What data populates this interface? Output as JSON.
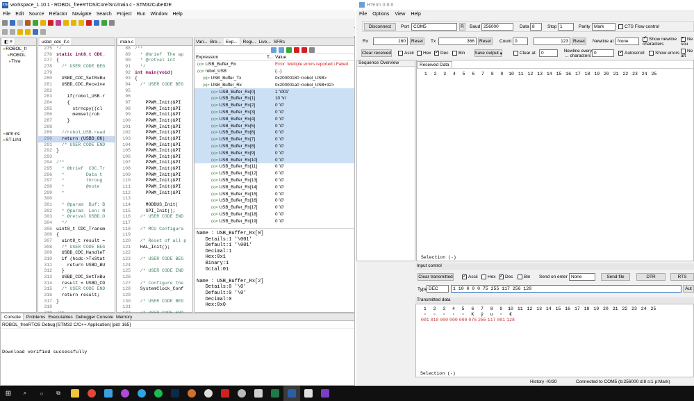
{
  "ide": {
    "title": "workspace_1.10.1 - ROBOL_freeRTOS/Core/Src/main.c - STM32CubeIDE",
    "menu": [
      "File",
      "Edit",
      "Source",
      "Refactor",
      "Navigate",
      "Search",
      "Project",
      "Run",
      "Window",
      "Help"
    ],
    "project_tree": [
      "ROBOL_fr",
      "ROBOL",
      "Thre",
      "arm-nc",
      "ST-LINI"
    ],
    "editor1": {
      "tab": "usbd_cdc_if.c",
      "lines": [
        {
          "n": "275",
          "t": "*/",
          "c": "cm"
        },
        {
          "n": "276",
          "t": "static int8_t CDC_",
          "c": "kw"
        },
        {
          "n": "277",
          "t": "{",
          "c": ""
        },
        {
          "n": "278",
          "t": "  /* USER CODE BEG",
          "c": "cm"
        },
        {
          "n": "279",
          "t": "",
          "c": ""
        },
        {
          "n": "280",
          "t": "  USBD_CDC_SetRxBu",
          "c": ""
        },
        {
          "n": "281",
          "t": "  USBD_CDC_Receive",
          "c": ""
        },
        {
          "n": "282",
          "t": "",
          "c": ""
        },
        {
          "n": "283",
          "t": "    if(robol_USB.r",
          "c": ""
        },
        {
          "n": "284",
          "t": "    {",
          "c": ""
        },
        {
          "n": "285",
          "t": "      strncpy((cl",
          "c": ""
        },
        {
          "n": "286",
          "t": "      memset(rob",
          "c": ""
        },
        {
          "n": "287",
          "t": "    }",
          "c": ""
        },
        {
          "n": "288",
          "t": "",
          "c": ""
        },
        {
          "n": "289",
          "t": "  //robol_USB.read",
          "c": "cm"
        },
        {
          "n": "290",
          "t": "  return (USBD_OK)",
          "c": "hl"
        },
        {
          "n": "291",
          "t": "  /* USER CODE END",
          "c": "cm"
        },
        {
          "n": "292",
          "t": "}",
          "c": ""
        },
        {
          "n": "293",
          "t": "",
          "c": ""
        },
        {
          "n": "294",
          "t": "/**",
          "c": "cm"
        },
        {
          "n": "295",
          "t": "  * @brief  CDC_Tr",
          "c": "cm"
        },
        {
          "n": "296",
          "t": "  *        Data t",
          "c": "cm"
        },
        {
          "n": "297",
          "t": "  *        throug",
          "c": "cm"
        },
        {
          "n": "298",
          "t": "  *        @note",
          "c": "cm"
        },
        {
          "n": "299",
          "t": "  *",
          "c": "cm"
        },
        {
          "n": "300",
          "t": "",
          "c": ""
        },
        {
          "n": "301",
          "t": "  * @param  Buf: B",
          "c": "cm"
        },
        {
          "n": "302",
          "t": "  * @param  Len: N",
          "c": "cm"
        },
        {
          "n": "303",
          "t": "  * @retval USBD_O",
          "c": "cm"
        },
        {
          "n": "304",
          "t": "  */",
          "c": "cm"
        },
        {
          "n": "305",
          "t": "uint8_t CDC_Transm",
          "c": ""
        },
        {
          "n": "306",
          "t": "{",
          "c": ""
        },
        {
          "n": "307",
          "t": "  uint8_t result =",
          "c": ""
        },
        {
          "n": "308",
          "t": "  /* USER CODE BEG",
          "c": "cm"
        },
        {
          "n": "309",
          "t": "  USBD_CDC_HandleT",
          "c": ""
        },
        {
          "n": "310",
          "t": "  if (hcdc->TxStat",
          "c": ""
        },
        {
          "n": "311",
          "t": "    return USBD_BU",
          "c": ""
        },
        {
          "n": "312",
          "t": "  }",
          "c": ""
        },
        {
          "n": "313",
          "t": "  USBD_CDC_SetTxBu",
          "c": ""
        },
        {
          "n": "314",
          "t": "  result = USBD_CD",
          "c": ""
        },
        {
          "n": "315",
          "t": "  /* USER CODE END",
          "c": "cm"
        },
        {
          "n": "316",
          "t": "  return result;",
          "c": ""
        },
        {
          "n": "317",
          "t": "}",
          "c": ""
        },
        {
          "n": "318",
          "t": "",
          "c": ""
        },
        {
          "n": "319",
          "t": "/**",
          "c": "cm"
        }
      ]
    },
    "editor2": {
      "tab": "main.c",
      "lines": [
        {
          "n": "88",
          "t": "/**",
          "c": "cm"
        },
        {
          "n": "89",
          "t": "  * @brief  The ap",
          "c": "cm"
        },
        {
          "n": "90",
          "t": "  * @retval int",
          "c": "cm"
        },
        {
          "n": "91",
          "t": "  */",
          "c": "cm"
        },
        {
          "n": "92",
          "t": "int main(void)",
          "c": "kw"
        },
        {
          "n": "93",
          "t": "{",
          "c": ""
        },
        {
          "n": "94",
          "t": "  /* USER CODE BEG",
          "c": "cm"
        },
        {
          "n": "95",
          "t": "",
          "c": ""
        },
        {
          "n": "96",
          "t": "",
          "c": ""
        },
        {
          "n": "97",
          "t": "    PPWM_Init(&PI",
          "c": ""
        },
        {
          "n": "98",
          "t": "    PPWM_Init(&PI",
          "c": ""
        },
        {
          "n": "99",
          "t": "    PPWM_Init(&PI",
          "c": ""
        },
        {
          "n": "100",
          "t": "    PPWM_Init(&PI",
          "c": ""
        },
        {
          "n": "101",
          "t": "    PPWM_Init(&PI",
          "c": ""
        },
        {
          "n": "102",
          "t": "    PPWM_Init(&PI",
          "c": ""
        },
        {
          "n": "103",
          "t": "    PPWM_Init(&PI",
          "c": ""
        },
        {
          "n": "104",
          "t": "    PPWM_Init(&PI",
          "c": ""
        },
        {
          "n": "105",
          "t": "    PPWM_Init(&PI",
          "c": ""
        },
        {
          "n": "106",
          "t": "    PPWM_Init(&PI",
          "c": ""
        },
        {
          "n": "107",
          "t": "    PPWM_Init(&PI",
          "c": ""
        },
        {
          "n": "108",
          "t": "    PPWM_Init(&PI",
          "c": ""
        },
        {
          "n": "109",
          "t": "    PPWM_Init(&PI",
          "c": ""
        },
        {
          "n": "110",
          "t": "    PPWM_Init(&PI",
          "c": ""
        },
        {
          "n": "111",
          "t": "    PPWM_Init(&PI",
          "c": ""
        },
        {
          "n": "112",
          "t": "    PPWM_Init(&PI",
          "c": ""
        },
        {
          "n": "113",
          "t": "",
          "c": ""
        },
        {
          "n": "114",
          "t": "    MODBUS_Init(",
          "c": ""
        },
        {
          "n": "115",
          "t": "    SPI_Init();",
          "c": ""
        },
        {
          "n": "116",
          "t": "  /* USER CODE END",
          "c": "cm"
        },
        {
          "n": "117",
          "t": "",
          "c": ""
        },
        {
          "n": "118",
          "t": "  /* MCU Configura",
          "c": "cm"
        },
        {
          "n": "119",
          "t": "",
          "c": ""
        },
        {
          "n": "120",
          "t": "  /* Reset of all p",
          "c": "cm"
        },
        {
          "n": "121",
          "t": "  HAL_Init();",
          "c": ""
        },
        {
          "n": "122",
          "t": "",
          "c": ""
        },
        {
          "n": "123",
          "t": "  /* USER CODE BEG",
          "c": "cm"
        },
        {
          "n": "124",
          "t": "",
          "c": ""
        },
        {
          "n": "125",
          "t": "  /* USER CODE END",
          "c": "cm"
        },
        {
          "n": "126",
          "t": "",
          "c": ""
        },
        {
          "n": "127",
          "t": "  /* Configure the",
          "c": "cm"
        },
        {
          "n": "128",
          "t": "  SystemClock_Conf",
          "c": ""
        },
        {
          "n": "129",
          "t": "",
          "c": ""
        },
        {
          "n": "130",
          "t": "  /* USER CODE BEG",
          "c": "cm"
        },
        {
          "n": "131",
          "t": "",
          "c": ""
        },
        {
          "n": "132",
          "t": "  /* USER CODE END",
          "c": "cm"
        }
      ]
    },
    "expressions": {
      "tabs": [
        "Vari...",
        "Bre...",
        "Exp...",
        "Regi...",
        "Live...",
        "SFRs"
      ],
      "col_expression": "Expression",
      "col_type": "T...",
      "col_value": "Value",
      "rows": [
        {
          "e": "USB_Buffer_Rx",
          "t": "",
          "v": "Error: Multiple errors reported.\\ Failed",
          "err": true,
          "sel": false,
          "ind": 4
        },
        {
          "e": "robol_USB",
          "t": "",
          "v": "{...}",
          "err": false,
          "sel": false,
          "ind": 4
        },
        {
          "e": "USB_Buffer_Tx",
          "t": "",
          "v": "0x20000180 <robol_USB>",
          "err": false,
          "sel": false,
          "ind": 12
        },
        {
          "e": "USB_Buffer_Rx",
          "t": "",
          "v": "0x200001a0 <robol_USB+32>",
          "err": false,
          "sel": false,
          "ind": 12
        },
        {
          "e": "USB_Buffer_Rx[0]",
          "t": "",
          "v": "1 '\\001'",
          "err": false,
          "sel": true,
          "ind": 24
        },
        {
          "e": "USB_Buffer_Rx[1]",
          "t": "",
          "v": "10 '\\n'",
          "err": false,
          "sel": true,
          "ind": 24
        },
        {
          "e": "USB_Buffer_Rx[2]",
          "t": "",
          "v": "0 '\\0'",
          "err": false,
          "sel": true,
          "ind": 24
        },
        {
          "e": "USB_Buffer_Rx[3]",
          "t": "",
          "v": "0 '\\0'",
          "err": false,
          "sel": true,
          "ind": 24
        },
        {
          "e": "USB_Buffer_Rx[4]",
          "t": "",
          "v": "0 '\\0'",
          "err": false,
          "sel": true,
          "ind": 24
        },
        {
          "e": "USB_Buffer_Rx[5]",
          "t": "",
          "v": "0 '\\0'",
          "err": false,
          "sel": true,
          "ind": 24
        },
        {
          "e": "USB_Buffer_Rx[6]",
          "t": "",
          "v": "0 '\\0'",
          "err": false,
          "sel": true,
          "ind": 24
        },
        {
          "e": "USB_Buffer_Rx[7]",
          "t": "",
          "v": "0 '\\0'",
          "err": false,
          "sel": true,
          "ind": 24
        },
        {
          "e": "USB_Buffer_Rx[8]",
          "t": "",
          "v": "0 '\\0'",
          "err": false,
          "sel": true,
          "ind": 24
        },
        {
          "e": "USB_Buffer_Rx[9]",
          "t": "",
          "v": "0 '\\0'",
          "err": false,
          "sel": true,
          "ind": 24
        },
        {
          "e": "USB_Buffer_Rx[10]",
          "t": "",
          "v": "0 '\\0'",
          "err": false,
          "sel": true,
          "ind": 24
        },
        {
          "e": "USB_Buffer_Rx[11]",
          "t": "",
          "v": "0 '\\0'",
          "err": false,
          "sel": false,
          "ind": 24
        },
        {
          "e": "USB_Buffer_Rx[12]",
          "t": "",
          "v": "0 '\\0'",
          "err": false,
          "sel": false,
          "ind": 24
        },
        {
          "e": "USB_Buffer_Rx[13]",
          "t": "",
          "v": "0 '\\0'",
          "err": false,
          "sel": false,
          "ind": 24
        },
        {
          "e": "USB_Buffer_Rx[14]",
          "t": "",
          "v": "0 '\\0'",
          "err": false,
          "sel": false,
          "ind": 24
        },
        {
          "e": "USB_Buffer_Rx[15]",
          "t": "",
          "v": "0 '\\0'",
          "err": false,
          "sel": false,
          "ind": 24
        },
        {
          "e": "USB_Buffer_Rx[16]",
          "t": "",
          "v": "0 '\\0'",
          "err": false,
          "sel": false,
          "ind": 24
        },
        {
          "e": "USB_Buffer_Rx[17]",
          "t": "",
          "v": "0 '\\0'",
          "err": false,
          "sel": false,
          "ind": 24
        },
        {
          "e": "USB_Buffer_Rx[18]",
          "t": "",
          "v": "0 '\\0'",
          "err": false,
          "sel": false,
          "ind": 24
        },
        {
          "e": "USB_Buffer_Rx[19]",
          "t": "",
          "v": "0 '\\0'",
          "err": false,
          "sel": false,
          "ind": 24
        }
      ],
      "details": [
        "Name : USB_Buffer_Rx[0]",
        "   Details:1 '\\001'",
        "   Default:1 '\\001'",
        "   Decimal:1",
        "   Hex:0x1",
        "   Binary:1",
        "   Octal:01",
        "",
        "Name : USB_Buffer_Rx[2]",
        "   Details:0 '\\0'",
        "   Default:0 '\\0'",
        "   Decimal:0",
        "   Hex:0x0"
      ]
    },
    "console": {
      "tabs": [
        "Console",
        "Problems",
        "Executables",
        "Debugger Console",
        "Memory"
      ],
      "session": "ROBOL_freeRTOS Debug [STM32 C/C++ Application] [pid: 165]",
      "message": "Download verified successfully"
    }
  },
  "hterm": {
    "title": "HTerm 0.8.8",
    "menu": [
      "File",
      "Options",
      "View",
      "Help"
    ],
    "disconnect": "Disconnect",
    "port_label": "Port",
    "port_value": "COM5",
    "r_button": "R",
    "baud_label": "Baud",
    "baud_value": "256000",
    "data_label": "Data",
    "data_value": "8",
    "stop_label": "Stop",
    "stop_value": "1",
    "parity_label": "Parity",
    "parity_value": "Mark",
    "cts_label": "CTS Flow control",
    "rx_label": "Rx",
    "rx_value": "160",
    "reset": "Reset",
    "tx_label": "Tx",
    "tx_value": "366",
    "count_label": "Count",
    "count_value": "0",
    "count_value2": "123",
    "newline_at_label": "Newline at",
    "newline_at_value": "None",
    "show_newline": "Show newline characters",
    "ne_cut": "Ne sou",
    "clear_received": "Clear received",
    "ascii": "Ascii",
    "hex": "Hex",
    "dec": "Dec",
    "bin": "Bin",
    "save_output": "Save output",
    "clear_at": "Clear at",
    "clear_at_value": "0",
    "newline_every": "Newline every ... characters",
    "newline_every_value": "0",
    "autoscroll": "Autoscroll",
    "show_errors": "Show errors",
    "ne_cut2": "Ne aft",
    "sequence_overview": "Sequence Overview",
    "received_data": "Received Data",
    "columns": [
      "1",
      "2",
      "3",
      "4",
      "5",
      "6",
      "7",
      "8",
      "9",
      "10",
      "11",
      "12",
      "13",
      "14",
      "15",
      "16",
      "17",
      "18",
      "19",
      "20",
      "21",
      "22",
      "23",
      "24",
      "25"
    ],
    "selection": "Selection (-)",
    "input_control": "Input control",
    "clear_transmitted": "Clear transmitted",
    "send_on_enter": "Send on enter",
    "send_on_enter_value": "None",
    "send_file": "Send file",
    "dtr": "DTR",
    "rts": "RTS",
    "type_label": "Type",
    "type_value": "DEC",
    "input_value": "1 10 0 0 0 75 255 117 256 128",
    "auto_cut": "Aut",
    "transmitted_data": "Transmitted data",
    "tx_symbols": [
      "▫",
      "▫",
      "▫",
      "▫",
      "▫",
      "K",
      "ÿ",
      "u",
      "▫",
      "€"
    ],
    "tx_values": [
      "001",
      "010",
      "000",
      "000",
      "000",
      "075",
      "255",
      "117",
      "001",
      "128"
    ],
    "selection2": "Selection (-)",
    "history": "History -/0/30",
    "status": "Connected to COM5 (b:256000 d:8 s:1 p:Mark)"
  }
}
